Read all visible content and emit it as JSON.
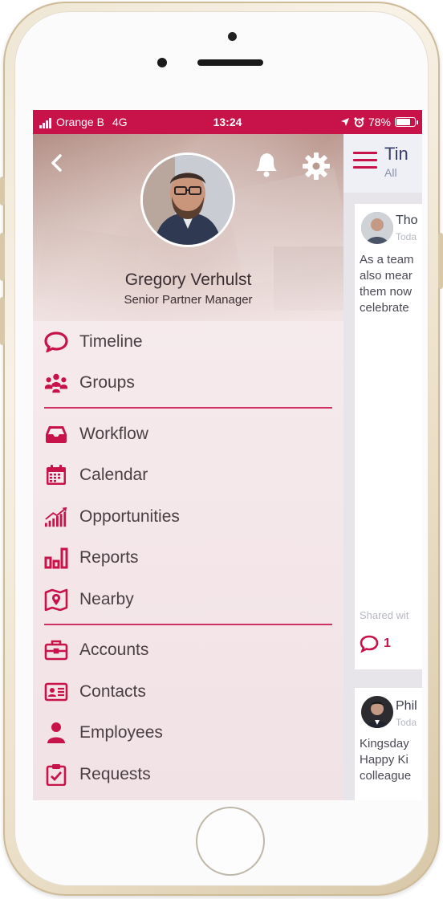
{
  "status_bar": {
    "carrier": "Orange B",
    "network": "4G",
    "time": "13:24",
    "battery": "78%",
    "battery_level": 0.78
  },
  "profile": {
    "name": "Gregory Verhulst",
    "role": "Senior Partner Manager"
  },
  "menu": {
    "group1": [
      {
        "label": "Timeline",
        "icon": "chat-bubble-icon"
      },
      {
        "label": "Groups",
        "icon": "people-group-icon"
      }
    ],
    "group2": [
      {
        "label": "Workflow",
        "icon": "inbox-tray-icon"
      },
      {
        "label": "Calendar",
        "icon": "calendar-icon"
      },
      {
        "label": "Opportunities",
        "icon": "trend-chart-icon"
      },
      {
        "label": "Reports",
        "icon": "bar-chart-icon"
      },
      {
        "label": "Nearby",
        "icon": "map-pin-icon"
      }
    ],
    "group3": [
      {
        "label": "Accounts",
        "icon": "briefcase-icon"
      },
      {
        "label": "Contacts",
        "icon": "contact-card-icon"
      },
      {
        "label": "Employees",
        "icon": "person-icon"
      },
      {
        "label": "Requests",
        "icon": "clipboard-check-icon"
      }
    ]
  },
  "timeline": {
    "title": "Tin",
    "filter": "All",
    "posts": [
      {
        "author": "Tho",
        "time": "Toda",
        "lines": [
          "As a team",
          "also mear",
          "them now",
          "celebrate"
        ],
        "shared": "Shared wit",
        "comment_count": "1"
      },
      {
        "author": "Phil",
        "time": "Toda",
        "lines": [
          "Kingsday",
          "Happy Ki",
          "colleague"
        ]
      }
    ]
  },
  "colors": {
    "accent": "#c8124a",
    "menu_text": "#4a3f44",
    "phone_frame": "#efe6d4"
  }
}
